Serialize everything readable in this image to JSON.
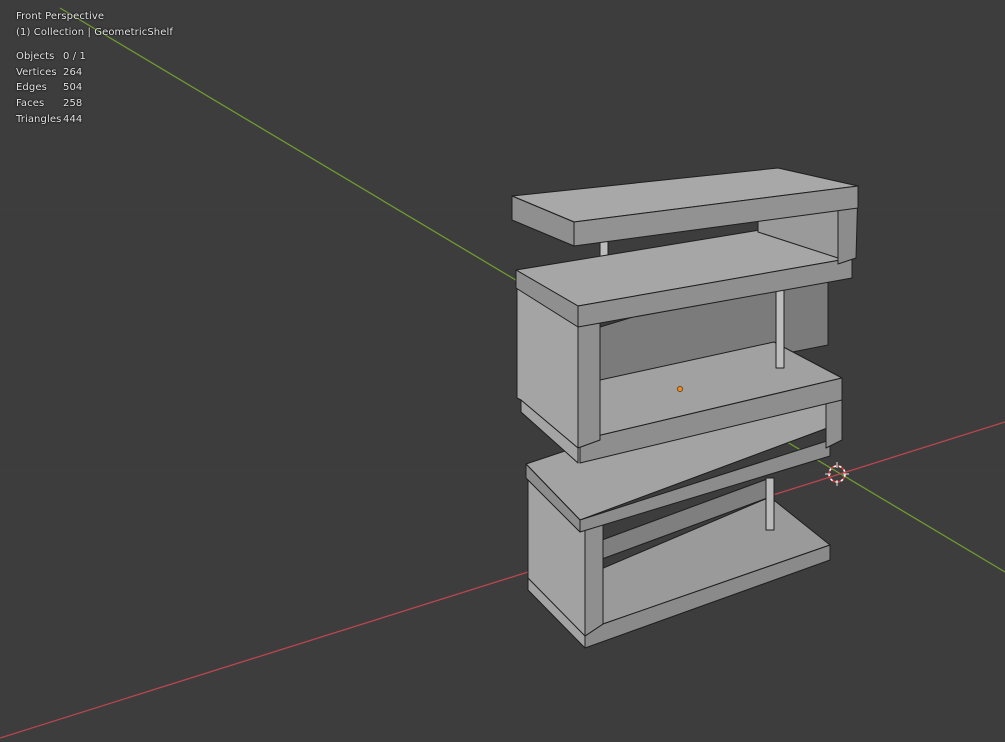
{
  "viewport": {
    "view_name": "Front Perspective",
    "collection_info": "(1) Collection | GeometricShelf"
  },
  "stats": [
    {
      "label": "Objects",
      "value": "0 / 1"
    },
    {
      "label": "Vertices",
      "value": "264"
    },
    {
      "label": "Edges",
      "value": "504"
    },
    {
      "label": "Faces",
      "value": "258"
    },
    {
      "label": "Triangles",
      "value": "444"
    }
  ],
  "colors": {
    "background": "#3d3d3d",
    "x_axis": "#c04a52",
    "y_axis": "#6f9a32",
    "origin": "#f08a1c"
  }
}
